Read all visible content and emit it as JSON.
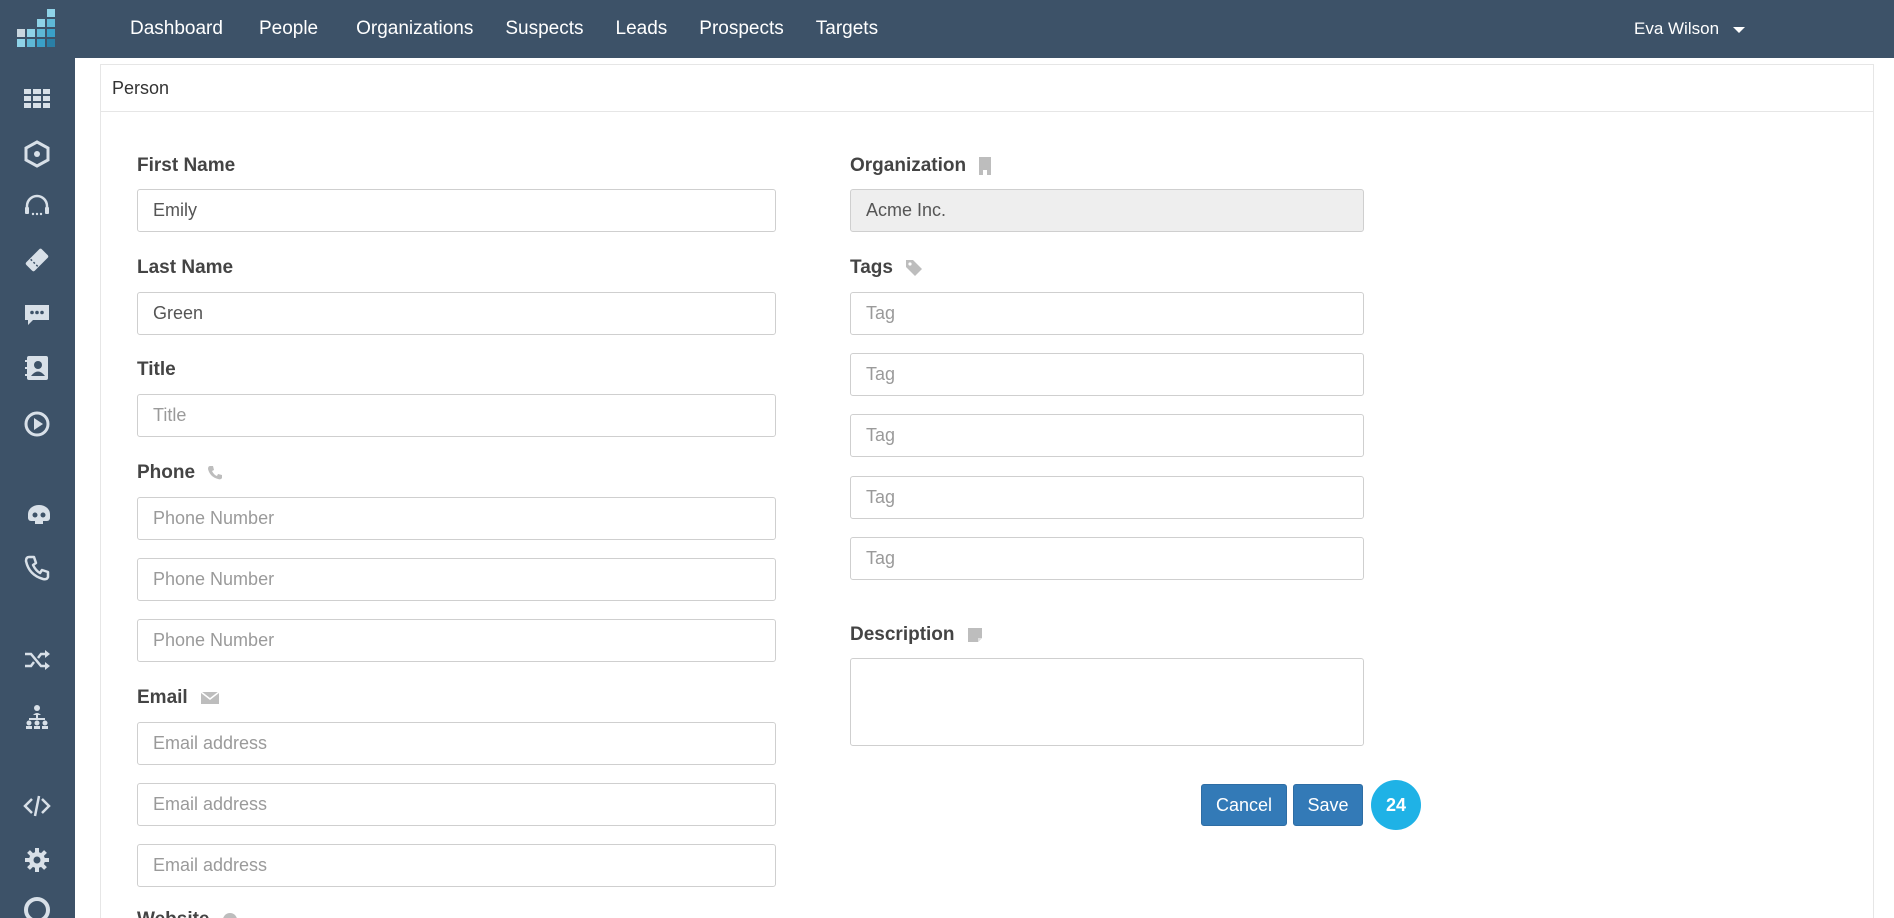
{
  "nav": {
    "items": [
      "Dashboard",
      "People",
      "Organizations",
      "Suspects",
      "Leads",
      "Prospects",
      "Targets"
    ]
  },
  "user": {
    "name": "Eva Wilson"
  },
  "sidebar": {
    "icons": [
      "grid-icon",
      "hexagon-icon",
      "headset-icon",
      "ticket-icon",
      "chat-icon",
      "contacts-icon",
      "play-icon",
      "bot-icon",
      "phone-icon",
      "shuffle-icon",
      "org-chart-icon",
      "code-icon",
      "gear-icon",
      "lifebuoy-icon"
    ]
  },
  "panel": {
    "title": "Person"
  },
  "form": {
    "first_name": {
      "label": "First Name",
      "value": "Emily"
    },
    "last_name": {
      "label": "Last Name",
      "value": "Green"
    },
    "title": {
      "label": "Title",
      "placeholder": "Title"
    },
    "phone": {
      "label": "Phone",
      "placeholder": "Phone Number"
    },
    "email": {
      "label": "Email",
      "placeholder": "Email address"
    },
    "website": {
      "label": "Website"
    },
    "organization": {
      "label": "Organization",
      "value": "Acme Inc."
    },
    "tags": {
      "label": "Tags",
      "placeholder": "Tag"
    },
    "description": {
      "label": "Description"
    }
  },
  "actions": {
    "cancel": "Cancel",
    "save": "Save",
    "badge": "24"
  },
  "colors": {
    "header": "#3d5268",
    "primary": "#337ab7",
    "badge": "#1fb2e6"
  }
}
